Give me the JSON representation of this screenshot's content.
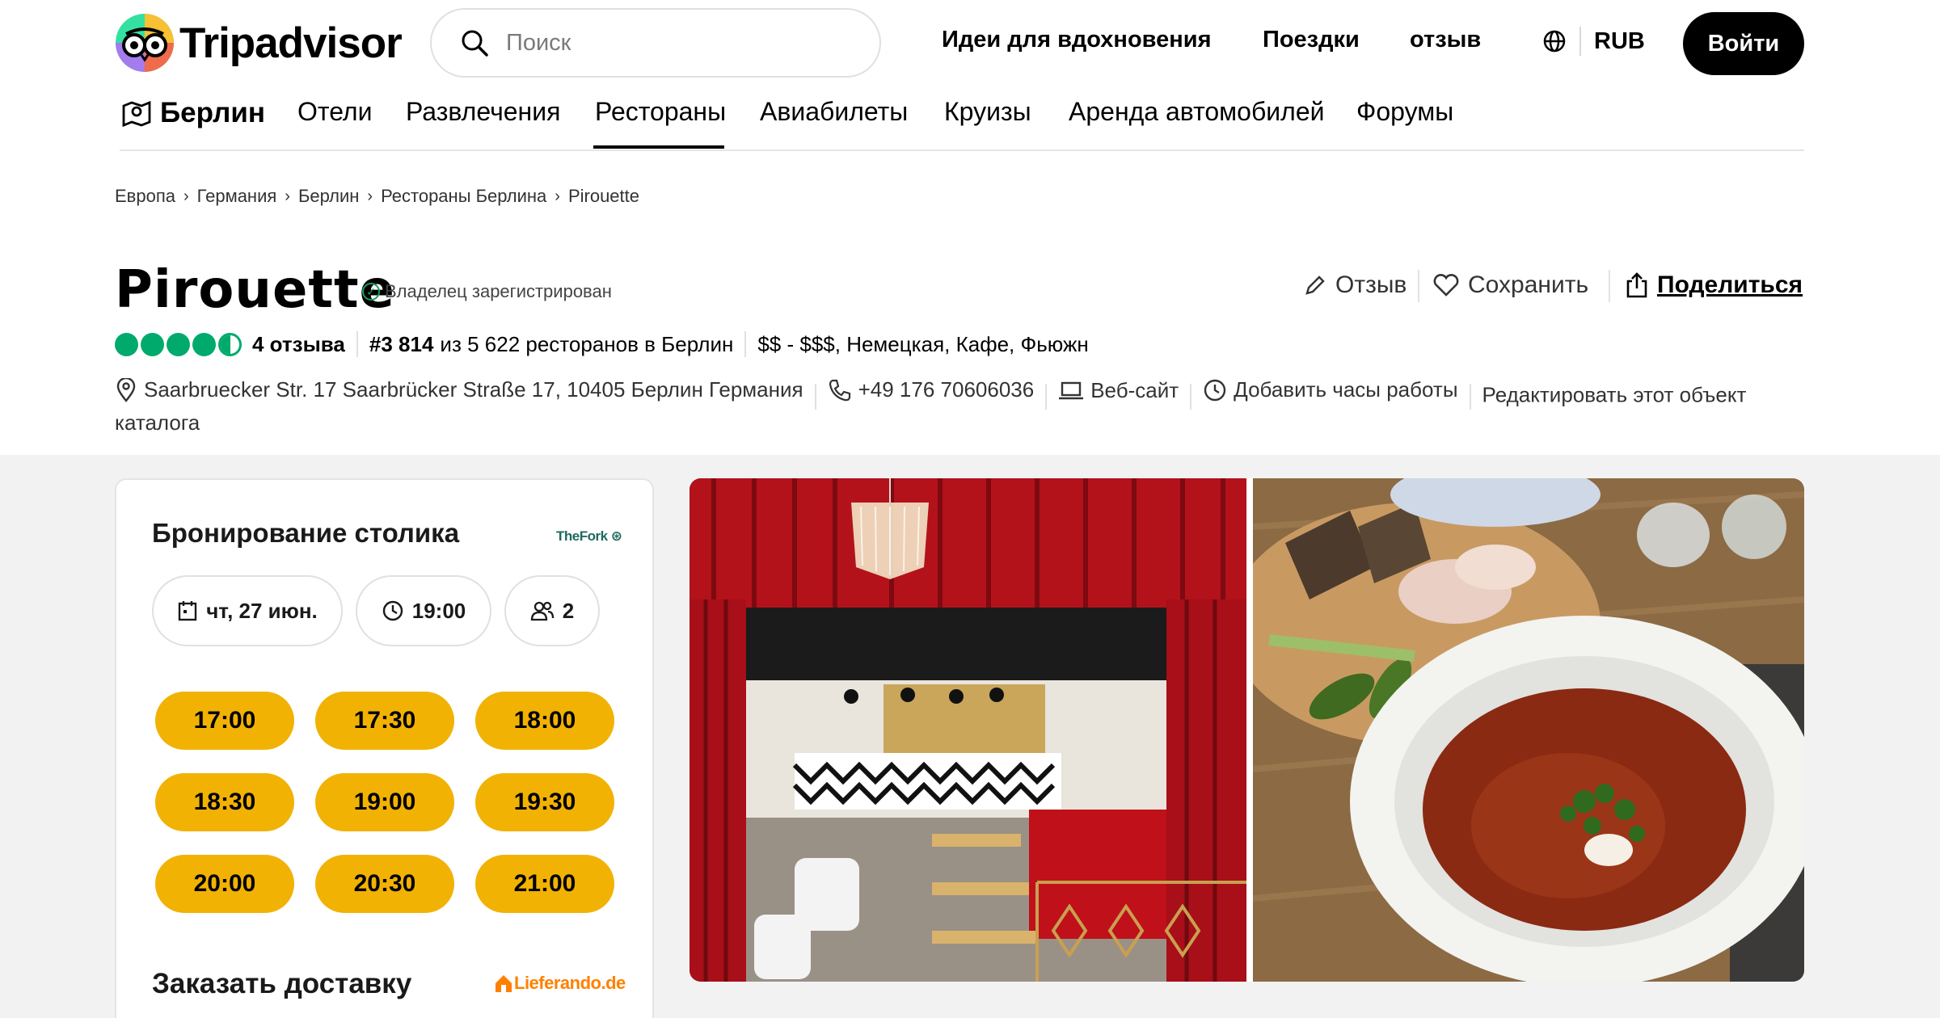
{
  "header": {
    "logo_text": "Tripadvisor",
    "search_placeholder": "Поиск",
    "nav": [
      "Идеи для вдохновения",
      "Поездки",
      "отзыв"
    ],
    "currency": "RUB",
    "login_label": "Войти"
  },
  "categories": {
    "location": "Берлин",
    "items": [
      "Отели",
      "Развлечения",
      "Рестораны",
      "Авиабилеты",
      "Круизы",
      "Аренда автомобилей",
      "Форумы"
    ],
    "active": "Рестораны"
  },
  "breadcrumb": [
    "Европа",
    "Германия",
    "Берлин",
    "Рестораны Берлина",
    "Pirouette"
  ],
  "restaurant": {
    "name": "Pirouette",
    "owner_badge": "Владелец зарегистрирован",
    "rating": 4.5,
    "reviews": "4 отзыва",
    "rank_bold": "#3 814",
    "rank_rest": "из 5 622 ресторанов в Берлин",
    "price_cuisine": "$$ - $$$, Немецкая, Кафе, Фьюжн",
    "address": "Saarbruecker Str. 17 Saarbrücker Straße 17, 10405 Берлин Германия",
    "phone": "+49 176 70606036",
    "website": "Веб-сайт",
    "hours": "Добавить часы работы",
    "edit": "Редактировать этот объект каталога"
  },
  "actions": {
    "review": "Отзыв",
    "save": "Сохранить",
    "share": "Поделиться"
  },
  "booking": {
    "title": "Бронирование столика",
    "partner": "TheFork",
    "date": "чт, 27 июн.",
    "time": "19:00",
    "guests": "2",
    "slots": [
      "17:00",
      "17:30",
      "18:00",
      "18:30",
      "19:00",
      "19:30",
      "20:00",
      "20:30",
      "21:00"
    ],
    "slot_color": "#f2b203",
    "delivery_title": "Заказать доставку",
    "delivery_partner": "Lieferando.de"
  },
  "colors": {
    "bubble": "#00aa6c",
    "accent_black": "#000000",
    "gray_bg": "#f2f2f2"
  }
}
